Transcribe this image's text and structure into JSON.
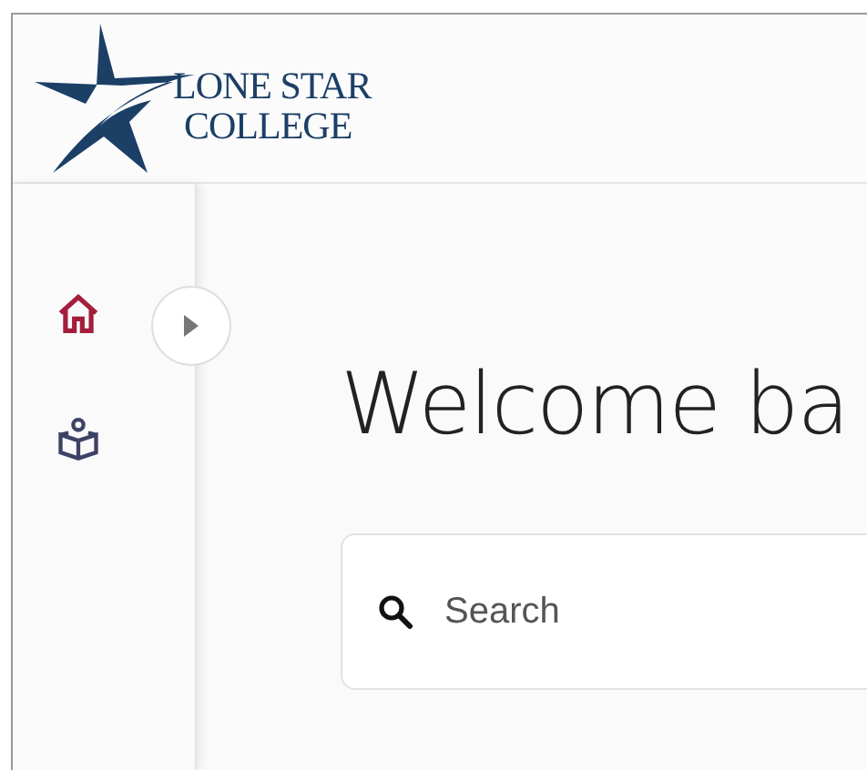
{
  "header": {
    "logo_lines": [
      "LONE STAR",
      "COLLEGE"
    ]
  },
  "sidebar": {
    "items": [
      {
        "kind": "home",
        "selected": true
      },
      {
        "kind": "reader",
        "selected": false
      }
    ],
    "expand_button": {
      "expanded": false
    }
  },
  "main": {
    "title": "Welcome ba",
    "search": {
      "placeholder": "Search"
    }
  }
}
